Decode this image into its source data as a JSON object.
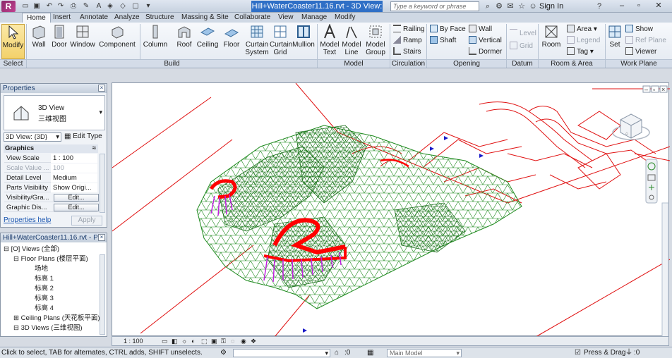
{
  "title_bar": {
    "title": "Hill+WaterCoaster11.16.rvt - 3D View: {3D}",
    "search_placeholder": "Type a keyword or phrase",
    "sign_in": "Sign In",
    "help": "?"
  },
  "tabs": [
    "Home",
    "Insert",
    "Annotate",
    "Analyze",
    "Structure",
    "Massing & Site",
    "Collaborate",
    "View",
    "Manage",
    "Modify"
  ],
  "ribbon": {
    "modify": "Modify",
    "wall": "Wall",
    "door": "Door",
    "window": "Window",
    "component": "Component",
    "column": "Column",
    "roof": "Roof",
    "ceiling": "Ceiling",
    "floor": "Floor",
    "curtain_system": "Curtain System",
    "curtain_grid": "Curtain Grid",
    "mullion": "Mullion",
    "model_text": "Model Text",
    "model_line": "Model Line",
    "model_group": "Model Group",
    "railing": "Railing",
    "ramp": "Ramp",
    "stairs": "Stairs",
    "by_face": "By Face",
    "shaft": "Shaft",
    "wall_opening": "Wall",
    "vertical": "Vertical",
    "dormer": "Dormer",
    "level": "Level",
    "grid": "Grid",
    "room": "Room",
    "area": "Area",
    "legend": "Legend",
    "tag": "Tag",
    "set": "Set",
    "show": "Show",
    "ref_plane": "Ref Plane",
    "viewer": "Viewer",
    "panels": {
      "select": "Select",
      "build": "Build",
      "model": "Model",
      "circulation": "Circulation",
      "opening": "Opening",
      "datum": "Datum",
      "room_area": "Room & Area",
      "work_plane": "Work Plane"
    }
  },
  "properties": {
    "header": "Properties",
    "type_name": "3D View",
    "type_sub": "三维视图",
    "selector": "3D View: {3D}",
    "edit_type": "Edit Type",
    "group": "Graphics",
    "rows": [
      {
        "k": "View Scale",
        "v": "1 : 100"
      },
      {
        "k": "Scale Value ...",
        "v": "100"
      },
      {
        "k": "Detail Level",
        "v": "Medium"
      },
      {
        "k": "Parts Visibility",
        "v": "Show Origi..."
      },
      {
        "k": "Visibility/Gra...",
        "v": "Edit..."
      },
      {
        "k": "Graphic Dis...",
        "v": "Edit..."
      }
    ],
    "help_link": "Properties help",
    "apply": "Apply"
  },
  "browser": {
    "header": "Hill+WaterCoaster11.16.rvt - Pr...",
    "items": [
      {
        "label": "[O] Views (全部)",
        "indent": 0
      },
      {
        "label": "Floor Plans (楼层平面)",
        "indent": 1
      },
      {
        "label": "场地",
        "indent": 2
      },
      {
        "label": "标高 1",
        "indent": 2
      },
      {
        "label": "标高 2",
        "indent": 2
      },
      {
        "label": "标高 3",
        "indent": 2
      },
      {
        "label": "标高 4",
        "indent": 2
      },
      {
        "label": "Ceiling Plans (天花板平面)",
        "indent": 1
      },
      {
        "label": "3D Views (三维视图)",
        "indent": 1
      }
    ]
  },
  "viewbar": {
    "scale": "1 : 100"
  },
  "status": {
    "hint": "Click to select, TAB for alternates, CTRL adds, SHIFT unselects.",
    "workset_count": ":0",
    "model": "Main Model",
    "press_drag": "Press & Drag",
    "filter_count": ":0"
  },
  "colors": {
    "terrain": "#1e8a1e",
    "site_lines": "#e01010",
    "coaster": "#ff0000",
    "supports": "#c020e0",
    "ribbon_active": "#2f6fc6"
  }
}
